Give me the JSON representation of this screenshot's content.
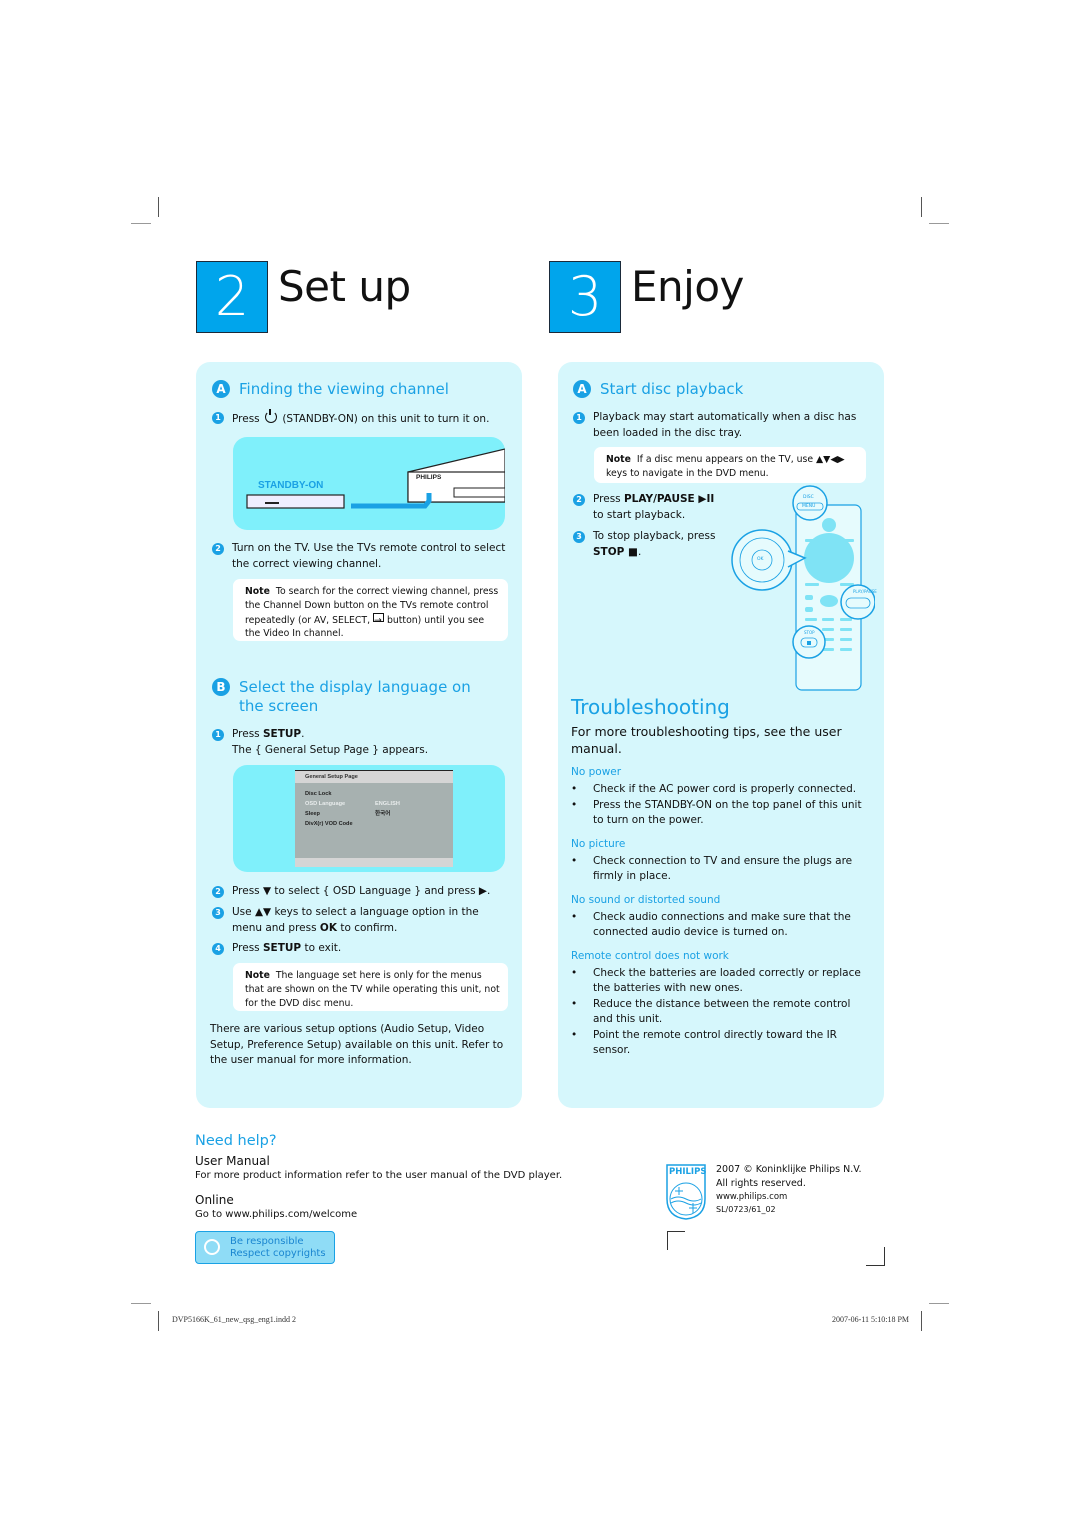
{
  "setup": {
    "step_number": "2",
    "title": "Set up",
    "section_a": {
      "letter": "A",
      "title": "Finding the viewing channel",
      "steps": [
        {
          "num": "1",
          "text_before": "Press",
          "icon": "power-icon",
          "text_after": "(STANDBY-ON) on this unit to turn it on."
        },
        {
          "num": "2",
          "text": "Turn on the TV. Use the TVs remote control to select the correct viewing channel."
        }
      ],
      "illustration": {
        "label": "STANDBY-ON",
        "brand": "PHILIPS"
      },
      "note": {
        "label": "Note",
        "text_before": "To search for the correct viewing channel, press the Channel Down button on the TVs remote control repeatedly (or AV, SELECT,",
        "icon": "input-source-icon",
        "text_after": "button) until you see the Video In channel."
      }
    },
    "section_b": {
      "letter": "B",
      "title": "Select the display language on the screen",
      "steps": [
        {
          "num": "1",
          "line1_prefix": "Press ",
          "line1_bold": "SETUP",
          "line1_suffix": ".",
          "line2": "The { General Setup Page } appears."
        },
        {
          "num": "2",
          "text": "Press ▼ to select { OSD Language } and press ▶."
        },
        {
          "num": "3",
          "prefix": "Use ▲▼ keys to select a language option in the menu and press ",
          "bold": "OK",
          "suffix": " to confirm."
        },
        {
          "num": "4",
          "prefix": "Press ",
          "bold": "SETUP",
          "suffix": " to exit."
        }
      ],
      "osd": {
        "title": "General Setup Page",
        "items": [
          {
            "label": "Disc Lock",
            "value": "",
            "highlighted": false
          },
          {
            "label": "OSD Language",
            "value": "ENGLISH",
            "highlighted": true
          },
          {
            "label": "Sleep",
            "value": "한국어",
            "highlighted": false
          },
          {
            "label": "DivX(r) VOD Code",
            "value": "",
            "highlighted": false
          }
        ]
      },
      "note": {
        "label": "Note",
        "text": "The language set here is only for the menus that are shown on the TV while operating this unit, not for the DVD disc menu."
      },
      "footer_text": "There are various setup options (Audio Setup, Video Setup, Preference Setup) available on this unit. Refer to the user manual for more information."
    }
  },
  "enjoy": {
    "step_number": "3",
    "title": "Enjoy",
    "section_a": {
      "letter": "A",
      "title": "Start disc playback",
      "steps": [
        {
          "num": "1",
          "text": "Playback may start automatically when a disc has been loaded in the disc tray."
        },
        {
          "num": "2",
          "prefix": "Press ",
          "bold": "PLAY/PAUSE ▶II",
          "suffix": "to start playback."
        },
        {
          "num": "3",
          "prefix": "To stop playback, press",
          "bold": "STOP ■",
          "suffix": "."
        }
      ],
      "note": {
        "label": "Note",
        "text": "If a disc menu appears on the TV, use ▲▼◀▶ keys to navigate in the DVD menu."
      },
      "remote": {
        "disc_menu_label": "DISC",
        "menu_label": "MENU",
        "ok_label": "OK",
        "play_pause_label": "PLAY/PAUSE",
        "stop_label": "STOP"
      }
    },
    "troubleshooting": {
      "title": "Troubleshooting",
      "intro": "For more troubleshooting tips, see the user manual.",
      "groups": [
        {
          "heading": "No power",
          "items": [
            "Check if the AC power cord is properly connected.",
            "Press the STANDBY-ON on the top panel of this unit to turn on the power."
          ]
        },
        {
          "heading": "No picture",
          "items": [
            "Check connection to TV and ensure the plugs are firmly in place."
          ]
        },
        {
          "heading": "No sound or distorted sound",
          "items": [
            "Check audio connections and make sure that the connected audio device is turned on."
          ]
        },
        {
          "heading": "Remote control does not work",
          "items": [
            "Check the batteries are loaded correctly or replace the batteries with new ones.",
            "Reduce the distance between the remote control and this unit.",
            "Point the remote control directly toward the IR sensor."
          ]
        }
      ]
    }
  },
  "help": {
    "title": "Need help?",
    "user_manual_heading": "User Manual",
    "user_manual_text": "For more product information refer to the user manual of the DVD player.",
    "online_heading": "Online",
    "online_text": "Go to www.philips.com/welcome",
    "badge_line1": "Be responsible",
    "badge_line2": "Respect copyrights"
  },
  "copyright": {
    "logo_text": "PHILIPS",
    "line1": "2007 © Koninklijke Philips N.V.",
    "line2": "All rights reserved.",
    "line3": "www.philips.com",
    "line4": "SL/0723/61_02"
  },
  "print_slug": {
    "file": "DVP5166K_61_new_qsg_eng1.indd   2",
    "timestamp": "2007-06-11   5:10:18 PM"
  },
  "colors": {
    "accent": "#1aa1e4",
    "step_box": "#00a5ec",
    "panel_bg": "#d6f7fc",
    "illustration_bg": "#7ff0fb"
  }
}
